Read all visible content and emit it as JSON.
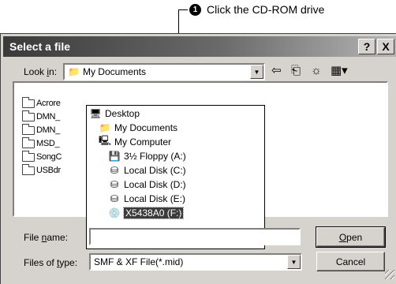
{
  "callout": {
    "number": "1",
    "text": "Click the CD-ROM drive"
  },
  "dialog": {
    "title": "Select a file",
    "help_glyph": "?",
    "close_glyph": "X",
    "look_in": {
      "label_prefix": "Look ",
      "label_accel": "i",
      "label_suffix": "n:",
      "value": "My Documents",
      "icon": "my-documents-icon"
    },
    "toolbar": {
      "back": "⇦",
      "up": "⎗",
      "new_folder": "☼",
      "view_menu": "▦▾"
    },
    "file_list": [
      "Acrore",
      "DMN_",
      "DMN_",
      "MSD_",
      "SongC",
      "USBdr"
    ],
    "dropdown": {
      "items": [
        {
          "label": "Desktop",
          "icon": "desktop-icon",
          "glyph": "🖥",
          "indent": 0,
          "selected": false
        },
        {
          "label": "My Documents",
          "icon": "folder-icon",
          "glyph": "📁",
          "indent": 1,
          "selected": false
        },
        {
          "label": "My Computer",
          "icon": "computer-icon",
          "glyph": "🖳",
          "indent": 1,
          "selected": false
        },
        {
          "label": "3½ Floppy (A:)",
          "icon": "floppy-icon",
          "glyph": "💾",
          "indent": 2,
          "selected": false
        },
        {
          "label": "Local Disk (C:)",
          "icon": "disk-icon",
          "glyph": "⛁",
          "indent": 2,
          "selected": false
        },
        {
          "label": "Local Disk (D:)",
          "icon": "disk-icon",
          "glyph": "⛁",
          "indent": 2,
          "selected": false
        },
        {
          "label": "Local Disk (E:)",
          "icon": "disk-icon",
          "glyph": "⛁",
          "indent": 2,
          "selected": false
        },
        {
          "label": "X5438A0 (F:)",
          "icon": "cd-drive-icon",
          "glyph": "💿",
          "indent": 2,
          "selected": true
        }
      ]
    },
    "file_name": {
      "label_prefix": "File ",
      "label_accel": "n",
      "label_suffix": "ame:",
      "value": ""
    },
    "files_of_type": {
      "label_prefix": "Files of ",
      "label_accel": "t",
      "label_suffix": "ype:",
      "value": "SMF & XF File(*.mid)"
    },
    "open_accel": "O",
    "open_rest": "pen",
    "cancel_label": "Cancel",
    "dropdown_arrow": "▼"
  },
  "colors": {
    "selection": "#3c3c3c",
    "dialog_bg": "#d6d3ce",
    "title_start": "#3a3a3a",
    "title_end": "#b5b5b5"
  }
}
